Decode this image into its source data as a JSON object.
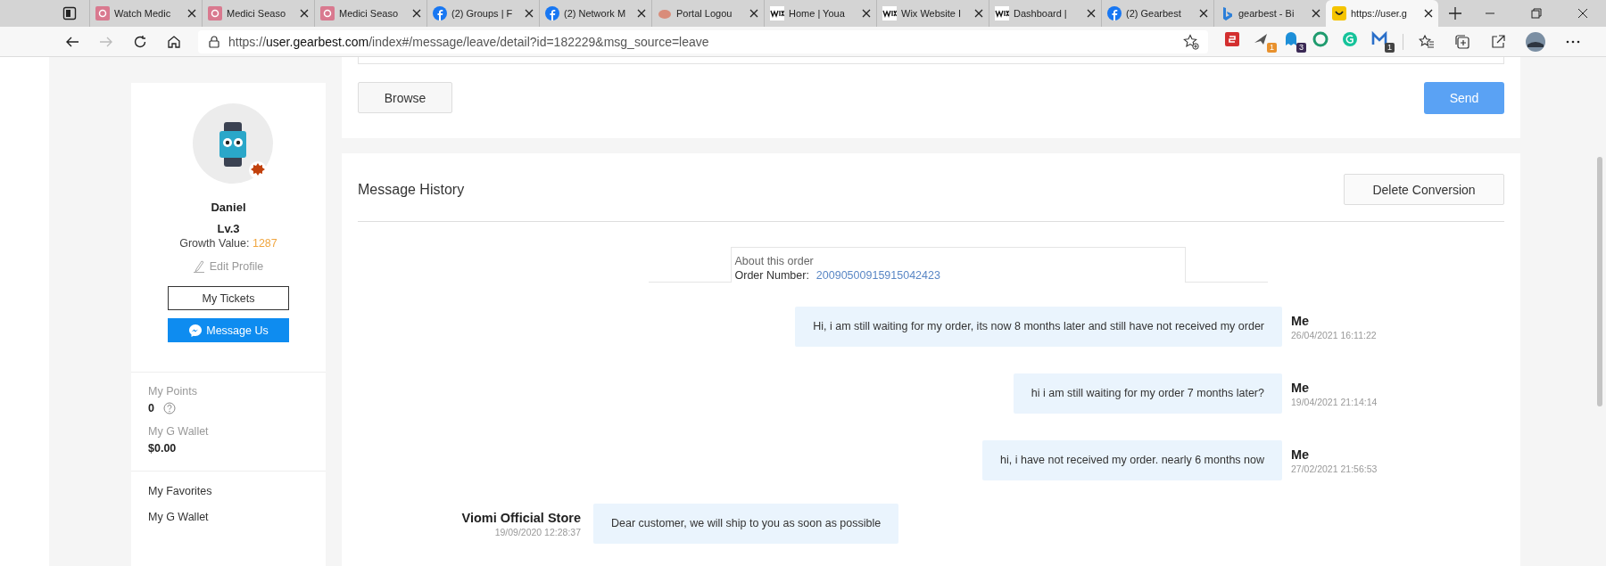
{
  "browser": {
    "tabs": [
      {
        "title": "Watch Medic",
        "kind": "e",
        "selected": false
      },
      {
        "title": "Medici Seaso",
        "kind": "e",
        "selected": false
      },
      {
        "title": "Medici Seaso",
        "kind": "e",
        "selected": false
      },
      {
        "title": "(2) Groups | F",
        "kind": "facebook",
        "selected": false
      },
      {
        "title": "(2) Network M",
        "kind": "facebook",
        "selected": false
      },
      {
        "title": "Portal Logou",
        "kind": "portal",
        "selected": false
      },
      {
        "title": "Home | Youa",
        "kind": "wix",
        "selected": false
      },
      {
        "title": "Wix Website I",
        "kind": "wix",
        "selected": false
      },
      {
        "title": "Dashboard |",
        "kind": "wix",
        "selected": false
      },
      {
        "title": "(2) Gearbest",
        "kind": "facebook",
        "selected": false
      },
      {
        "title": "gearbest - Bi",
        "kind": "bing",
        "selected": false
      },
      {
        "title": "https://user.g",
        "kind": "gearbest",
        "selected": true
      }
    ],
    "url": {
      "scheme": "https://",
      "host": "user.gearbest.com",
      "path": "/index#/message/leave/detail?id=182229&msg_source=leave"
    },
    "extensions": [
      {
        "kind": "square"
      },
      {
        "kind": "plane",
        "badge": "1",
        "color": "#e8912d"
      },
      {
        "kind": "ghost",
        "badge": "3",
        "color": "#3b2a55"
      },
      {
        "kind": "ring"
      },
      {
        "kind": "grammarly"
      },
      {
        "kind": "m",
        "badge": "1",
        "color": "#444444"
      }
    ]
  },
  "sidebar": {
    "name": "Daniel",
    "level": "Lv.3",
    "growth_label": "Growth Value:",
    "growth_value": "1287",
    "edit_profile": "Edit Profile",
    "tickets_button": "My Tickets",
    "message_button": "Message Us",
    "stats": [
      {
        "label": "My Points",
        "value": "0",
        "help": true
      },
      {
        "label": "My G Wallet",
        "value": "$0.00",
        "help": false
      }
    ],
    "links": [
      "My Favorites",
      "My G Wallet"
    ]
  },
  "compose": {
    "browse_button": "Browse",
    "send_button": "Send"
  },
  "history": {
    "title": "Message History",
    "delete_button": "Delete Conversion",
    "order": {
      "heading": "About this order",
      "number_label": "Order Number:",
      "number": "20090500915915042423"
    },
    "messages": [
      {
        "kind": "outgoing",
        "sender": "Me",
        "time": "26/04/2021 16:11:22",
        "text": "Hi, i am still waiting for my order, its now 8 months later and still have not received my order"
      },
      {
        "kind": "outgoing",
        "sender": "Me",
        "time": "19/04/2021 21:14:14",
        "text": "hi i am still waiting for my order 7 months later?"
      },
      {
        "kind": "outgoing",
        "sender": "Me",
        "time": "27/02/2021 21:56:53",
        "text": "hi, i have not received my order. nearly 6 months now"
      },
      {
        "kind": "incoming",
        "sender": "Viomi Official Store",
        "time": "19/09/2020 12:28:37",
        "text": "Dear customer, we will ship to you as soon as possible"
      }
    ]
  }
}
